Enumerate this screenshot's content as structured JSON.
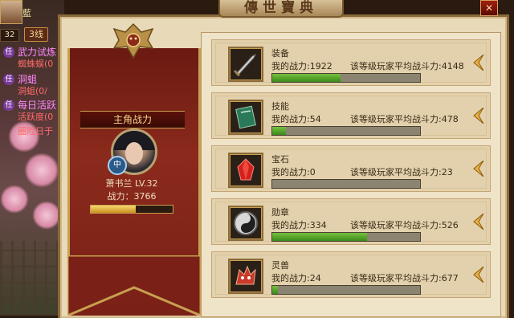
{
  "title": "傳世寶典",
  "close_label": "✕",
  "hud": {
    "name": "藍",
    "level": "32",
    "line": "3线",
    "quests": [
      {
        "title": "武力试炼",
        "sub": "蜘蛛蜈(0"
      },
      {
        "title": "洞蛆",
        "sub": "洞蛆(0/"
      },
      {
        "title": "每日活跃",
        "sub": "活跃度(0"
      },
      {
        "title": "",
        "sub": "圈险日于"
      }
    ]
  },
  "hero": {
    "section_title": "主角战力",
    "class_badge": "中",
    "name_level": "萧书兰  LV.32",
    "power_text": "战力：3766",
    "power_progress": 0.55
  },
  "rows": [
    {
      "name": "装备",
      "my": "我的战力:1922",
      "avg": "该等级玩家平均战斗力:4148",
      "progress": 0.46,
      "icon": "sword-icon"
    },
    {
      "name": "技能",
      "my": "我的战力:54",
      "avg": "该等级玩家平均战斗力:478",
      "progress": 0.09,
      "icon": "skill-book-icon"
    },
    {
      "name": "宝石",
      "my": "我的战力:0",
      "avg": "该等级玩家平均战斗力:23",
      "progress": 0.0,
      "icon": "gem-icon"
    },
    {
      "name": "勋章",
      "my": "我的战力:334",
      "avg": "该等级玩家平均战斗力:526",
      "progress": 0.64,
      "icon": "medal-icon"
    },
    {
      "name": "灵兽",
      "my": "我的战力:24",
      "avg": "该等级玩家平均战斗力:677",
      "progress": 0.04,
      "icon": "spirit-beast-icon"
    }
  ],
  "colors": {
    "banner": "#8a2a1c",
    "progress_green": "#5aa82a",
    "gold": "#c8a050",
    "panel": "#e8d9b8"
  }
}
